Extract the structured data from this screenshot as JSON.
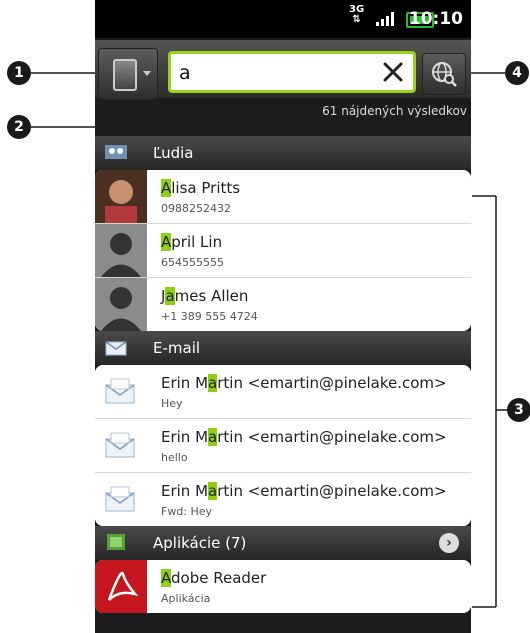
{
  "annotations": [
    "1",
    "2",
    "3",
    "4"
  ],
  "status_bar": {
    "network": "3G",
    "time": "10:10"
  },
  "search": {
    "value": "a",
    "result_count": "61  nájdených výsledkov"
  },
  "sections": {
    "people": {
      "title": "Ľudia",
      "items": [
        {
          "hl": "A",
          "rest": "lisa Pritts",
          "sub": "0988252432"
        },
        {
          "hl": "A",
          "rest": "pril Lin",
          "sub": "654555555"
        },
        {
          "pre": "J",
          "hl": "a",
          "rest": "mes Allen",
          "sub": "+1 389 555 4724"
        }
      ]
    },
    "email": {
      "title": "E-mail",
      "items": [
        {
          "pre": "Erin M",
          "hl": "a",
          "rest": "rtin <emartin@pinelake.com>",
          "sub": "Hey"
        },
        {
          "pre": "Erin M",
          "hl": "a",
          "rest": "rtin <emartin@pinelake.com>",
          "sub": "hello"
        },
        {
          "pre": "Erin M",
          "hl": "a",
          "rest": "rtin <emartin@pinelake.com>",
          "sub": "Fwd: Hey"
        }
      ]
    },
    "apps": {
      "title": "Aplikácie (7)",
      "items": [
        {
          "hl": "A",
          "rest": "dobe Reader",
          "sub": "Aplikácia"
        }
      ]
    }
  },
  "colors": {
    "highlight": "#8cd10f",
    "search_border": "#99d41b",
    "callout": "#1a1a1a"
  },
  "icons": [
    "phone-source-icon",
    "clear-icon",
    "web-search-icon",
    "people-icon",
    "email-icon",
    "apps-icon",
    "envelope-icon",
    "adobe-reader-icon",
    "chevron-right-icon"
  ]
}
